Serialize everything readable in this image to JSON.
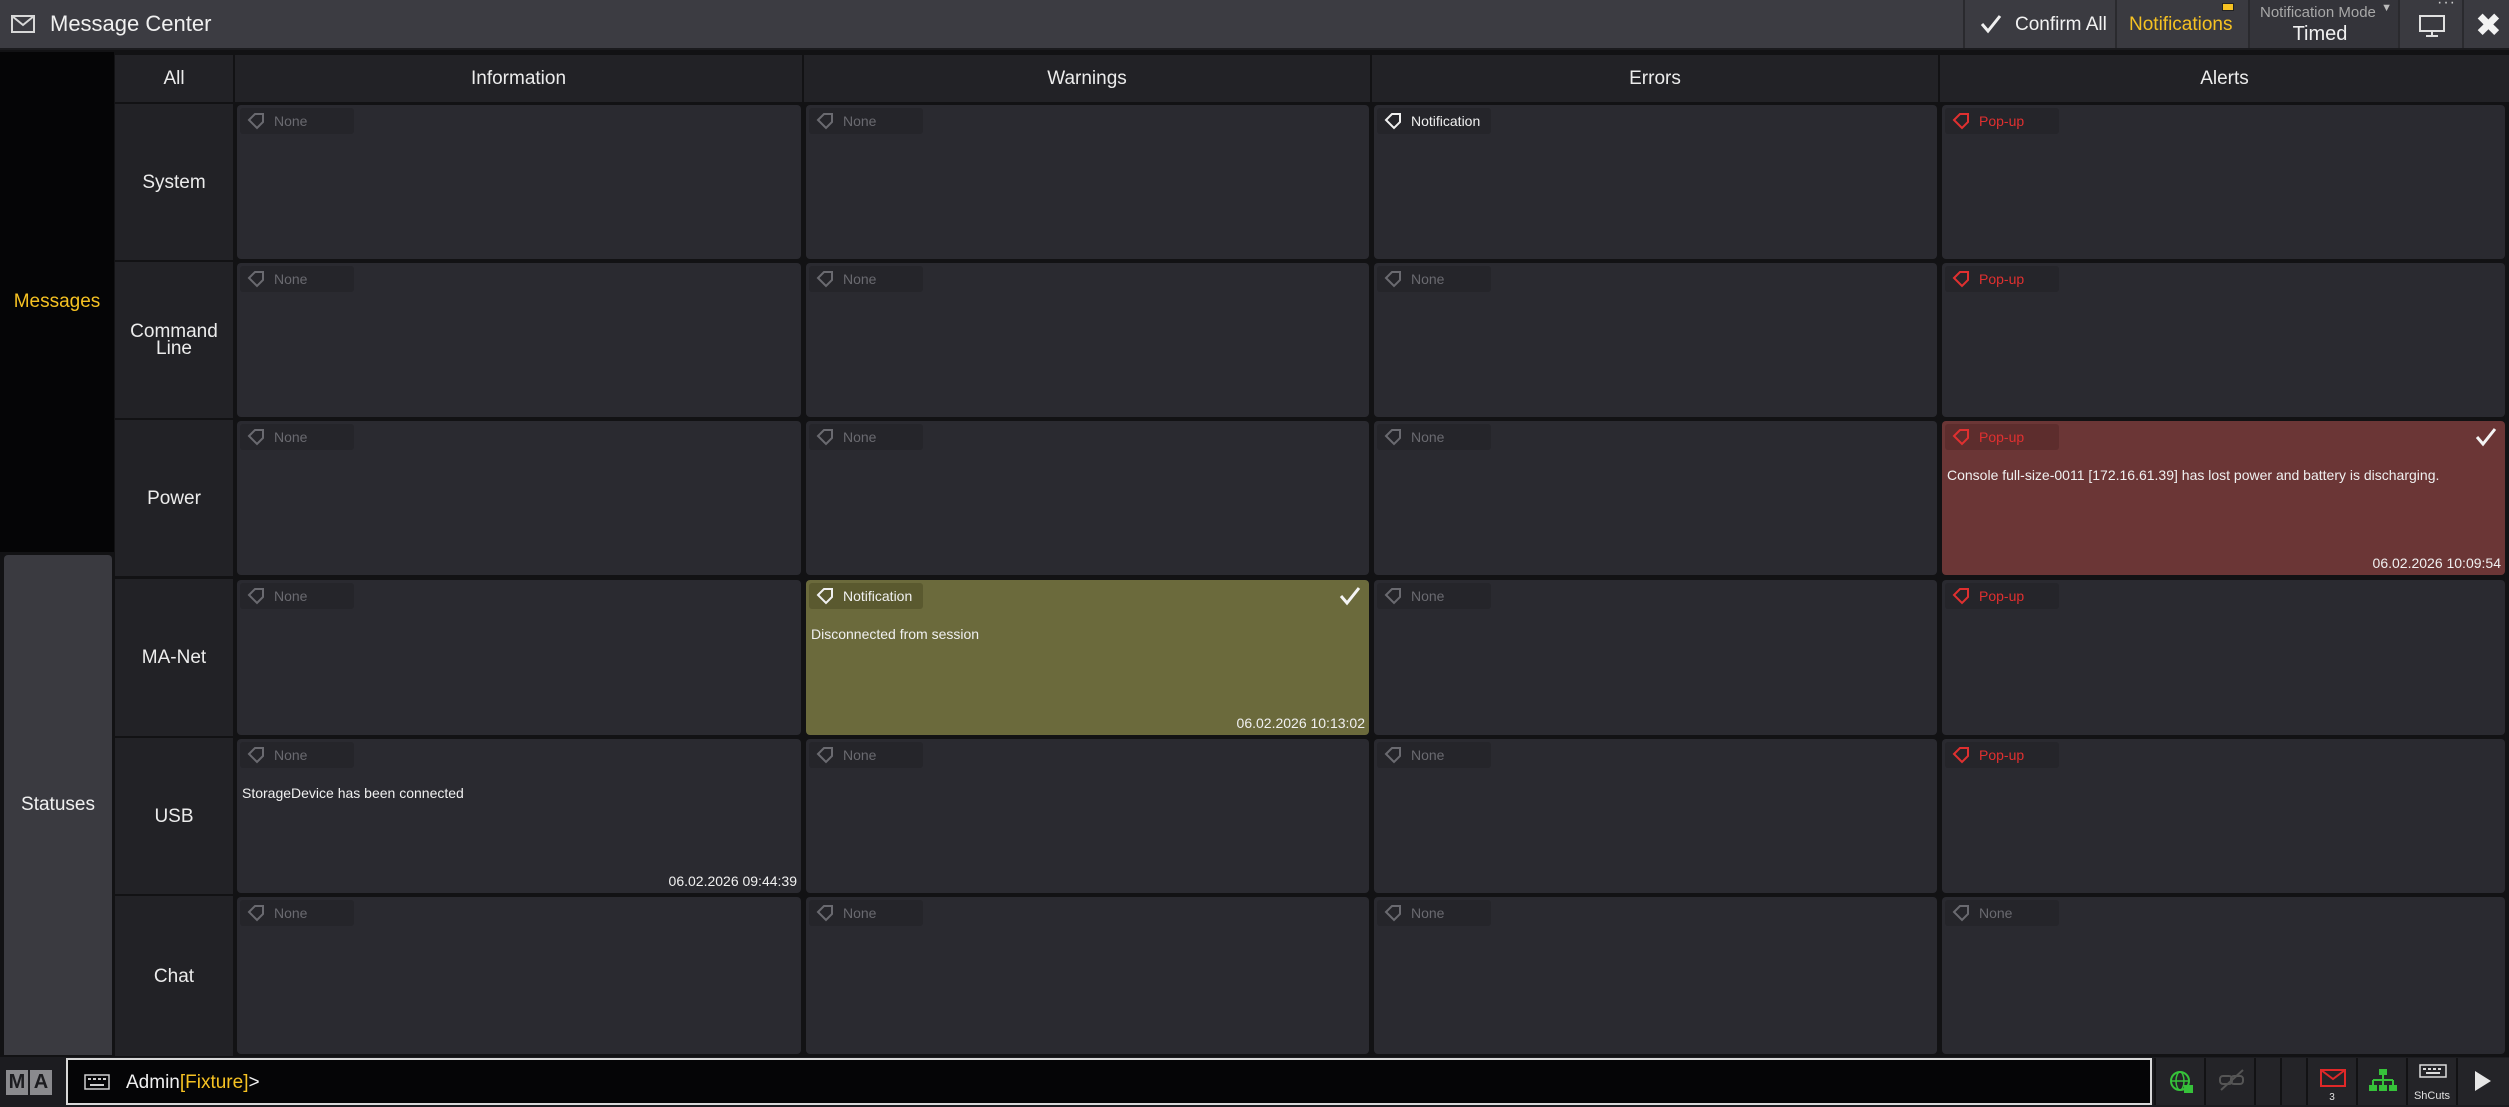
{
  "window": {
    "title": "Message Center"
  },
  "toolbar": {
    "confirm_all": "Confirm All",
    "notifications": "Notifications",
    "mode_label": "Notification Mode",
    "mode_value": "Timed",
    "close": "✖"
  },
  "nav": {
    "messages": "Messages",
    "statuses": "Statuses"
  },
  "columns": [
    "All",
    "Information",
    "Warnings",
    "Errors",
    "Alerts"
  ],
  "rows": [
    "System",
    "Command Line",
    "Power",
    "MA-Net",
    "USB",
    "Chat"
  ],
  "cells": {
    "system": [
      {
        "chip": "None"
      },
      {
        "chip": "None"
      },
      {
        "chip": "Notification"
      },
      {
        "chip": "Pop-up"
      }
    ],
    "cmdline": [
      {
        "chip": "None"
      },
      {
        "chip": "None"
      },
      {
        "chip": "None"
      },
      {
        "chip": "Pop-up"
      }
    ],
    "power": [
      {
        "chip": "None"
      },
      {
        "chip": "None"
      },
      {
        "chip": "None"
      },
      {
        "chip": "Pop-up",
        "message": "Console full-size-0011 [172.16.61.39] has lost power and battery is discharging.",
        "timestamp": "06.02.2026 10:09:54"
      }
    ],
    "manet": [
      {
        "chip": "None"
      },
      {
        "chip": "Notification",
        "message": "Disconnected from session",
        "timestamp": "06.02.2026 10:13:02"
      },
      {
        "chip": "None"
      },
      {
        "chip": "Pop-up"
      }
    ],
    "usb": [
      {
        "chip": "None",
        "message": "StorageDevice has been connected",
        "timestamp": "06.02.2026 09:44:39"
      },
      {
        "chip": "None"
      },
      {
        "chip": "None"
      },
      {
        "chip": "Pop-up"
      }
    ],
    "chat": [
      {
        "chip": "None"
      },
      {
        "chip": "None"
      },
      {
        "chip": "None"
      },
      {
        "chip": "None"
      }
    ]
  },
  "cmd": {
    "user": "Admin",
    "object": "[Fixture]",
    "suffix": ">"
  },
  "bottom": {
    "message_count": "3",
    "shortcuts": "ShCuts"
  },
  "logo": [
    "M",
    "A"
  ],
  "colors": {
    "accent": "#f6c222",
    "popup": "#e03030",
    "warning_bg": "#6b6a3c",
    "alert_bg": "#6b3636"
  }
}
